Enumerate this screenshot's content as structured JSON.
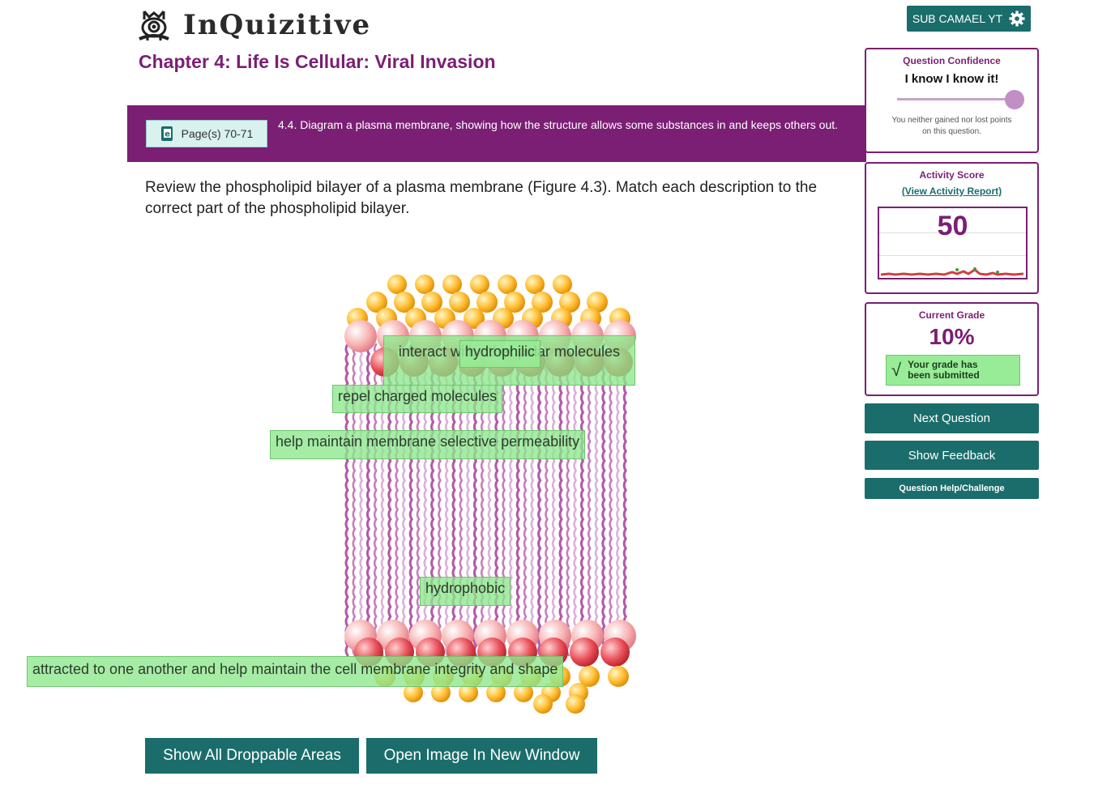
{
  "header": {
    "brand": "InQuizitive",
    "chapter_title": "Chapter 4: Life Is Cellular: Viral Invasion",
    "user_label": "SUB CAMAEL YT"
  },
  "banner": {
    "page_ref": "Page(s) 70-71",
    "objective": "4.4. Diagram a plasma membrane, showing how the structure allows some substances in and keeps others out."
  },
  "question": {
    "prompt": "Review the phospholipid bilayer of a plasma membrane (Figure 4.3). Match each description to the correct part of the phospholipid bilayer."
  },
  "answer_labels": [
    "interact with other polar molecules",
    "hydrophilic",
    "repel charged molecules",
    "help maintain membrane selective permeability",
    "hydrophobic",
    "attracted to one another and help maintain the cell membrane integrity and shape"
  ],
  "buttons": {
    "show_droppable": "Show All Droppable Areas",
    "open_image": "Open Image In New Window",
    "next_question": "Next Question",
    "show_feedback": "Show Feedback",
    "help": "Question Help/Challenge"
  },
  "confidence": {
    "title": "Question Confidence",
    "value": "I know I know it!",
    "slider_fraction": 1.0,
    "note": "You neither gained nor lost points on this question."
  },
  "activity": {
    "title": "Activity Score",
    "report_link": "(View Activity Report)",
    "score": "50"
  },
  "grade": {
    "title": "Current Grade",
    "value": "10%",
    "status": "Your grade has been submitted"
  },
  "colors": {
    "brand_purple": "#7a1f73",
    "teal": "#1a6d6b",
    "label_green": "#8ce88c"
  }
}
